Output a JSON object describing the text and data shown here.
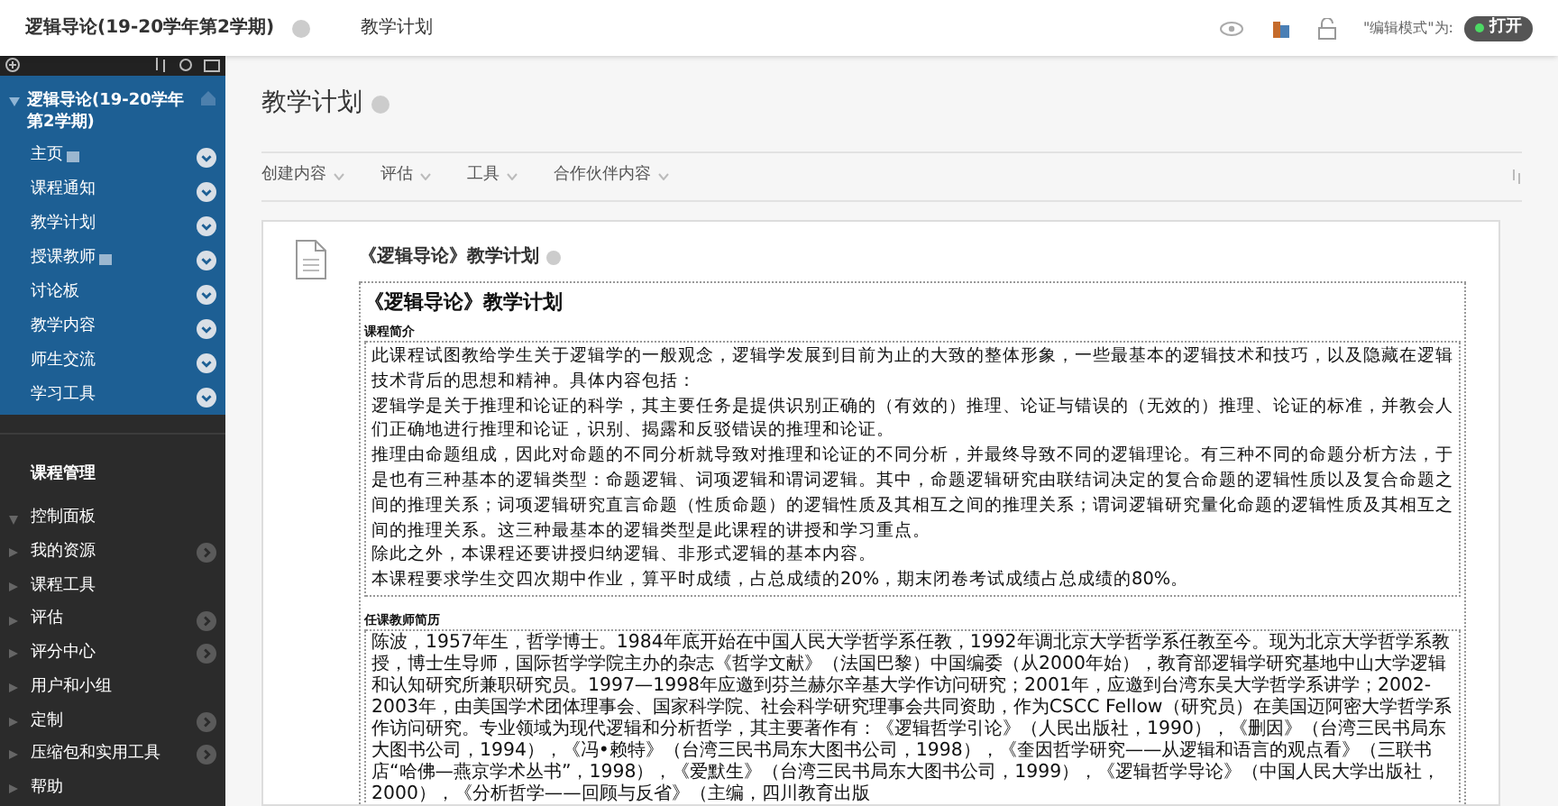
{
  "breadcrumb": {
    "course": "逻辑导论(19-20学年第2学期)",
    "page": "教学计划"
  },
  "edit_mode": {
    "label": "\"编辑模式\"为:",
    "value": "打开",
    "on": true
  },
  "sidebar": {
    "course_title": "逻辑导论(19-20学年第2学期)",
    "items": [
      {
        "label": "主页",
        "badge": true
      },
      {
        "label": "课程通知",
        "badge": false
      },
      {
        "label": "教学计划",
        "badge": false
      },
      {
        "label": "授课教师",
        "badge": true
      },
      {
        "label": "讨论板",
        "badge": false
      },
      {
        "label": "教学内容",
        "badge": false
      },
      {
        "label": "师生交流",
        "badge": false
      },
      {
        "label": "学习工具",
        "badge": false
      }
    ],
    "management_title": "课程管理",
    "management": [
      {
        "label": "控制面板",
        "expanded": true,
        "link": false
      },
      {
        "label": "我的资源",
        "expanded": false,
        "link": true
      },
      {
        "label": "课程工具",
        "expanded": false,
        "link": false
      },
      {
        "label": "评估",
        "expanded": false,
        "link": true
      },
      {
        "label": "评分中心",
        "expanded": false,
        "link": true
      },
      {
        "label": "用户和小组",
        "expanded": false,
        "link": false
      },
      {
        "label": "定制",
        "expanded": false,
        "link": true
      },
      {
        "label": "压缩包和实用工具",
        "expanded": false,
        "link": true
      },
      {
        "label": "帮助",
        "expanded": false,
        "link": false
      }
    ]
  },
  "page_title": "教学计划",
  "toolbar": [
    "创建内容",
    "评估",
    "工具",
    "合作伙伴内容"
  ],
  "item": {
    "title": "《逻辑导论》教学计划",
    "heading": "《逻辑导论》教学计划",
    "sections": [
      {
        "label": "课程简介",
        "paragraphs": [
          "此课程试图教给学生关于逻辑学的一般观念，逻辑学发展到目前为止的大致的整体形象，一些最基本的逻辑技术和技巧，以及隐藏在逻辑技术背后的思想和精神。具体内容包括：",
          "逻辑学是关于推理和论证的科学，其主要任务是提供识别正确的（有效的）推理、论证与错误的（无效的）推理、论证的标准，并教会人们正确地进行推理和论证，识别、揭露和反驳错误的推理和论证。",
          "推理由命题组成，因此对命题的不同分析就导致对推理和论证的不同分析，并最终导致不同的逻辑理论。有三种不同的命题分析方法，于是也有三种基本的逻辑类型：命题逻辑、词项逻辑和谓词逻辑。其中，命题逻辑研究由联结词决定的复合命题的逻辑性质以及复合命题之间的推理关系；词项逻辑研究直言命题（性质命题）的逻辑性质及其相互之间的推理关系；谓词逻辑研究量化命题的逻辑性质及其相互之间的推理关系。这三种最基本的逻辑类型是此课程的讲授和学习重点。",
          "除此之外，本课程还要讲授归纳逻辑、非形式逻辑的基本内容。",
          "本课程要求学生交四次期中作业，算平时成绩，占总成绩的20%，期末闭卷考试成绩占总成绩的80%。"
        ]
      },
      {
        "label": "任课教师简历",
        "paragraphs": [
          "陈波，1957年生，哲学博士。1984年底开始在中国人民大学哲学系任教，1992年调北京大学哲学系任教至今。现为北京大学哲学系教授，博士生导师，国际哲学学院主办的杂志《哲学文献》（法国巴黎）中国编委（从2000年始），教育部逻辑学研究基地中山大学逻辑和认知研究所兼职研究员。1997—1998年应邀到芬兰赫尔辛基大学作访问研究；2001年，应邀到台湾东吴大学哲学系讲学；2002-2003年，由美国学术团体理事会、国家科学院、社会科学研究理事会共同资助，作为CSCC Fellow（研究员）在美国迈阿密大学哲学系作访问研究。专业领域为现代逻辑和分析哲学，其主要著作有：《逻辑哲学引论》（人民出版社，1990），《删因》（台湾三民书局东大图书公司，1994），《冯•赖特》（台湾三民书局东大图书公司，1998），《奎因哲学研究——从逻辑和语言的观点看》（三联书店“哈佛—燕京学术丛书”，1998），《爱默生》（台湾三民书局东大图书公司，1999），《逻辑哲学导论》（中国人民大学出版社，2000），《分析哲学——回顾与反省》（主编，四川教育出版"
        ]
      }
    ]
  }
}
